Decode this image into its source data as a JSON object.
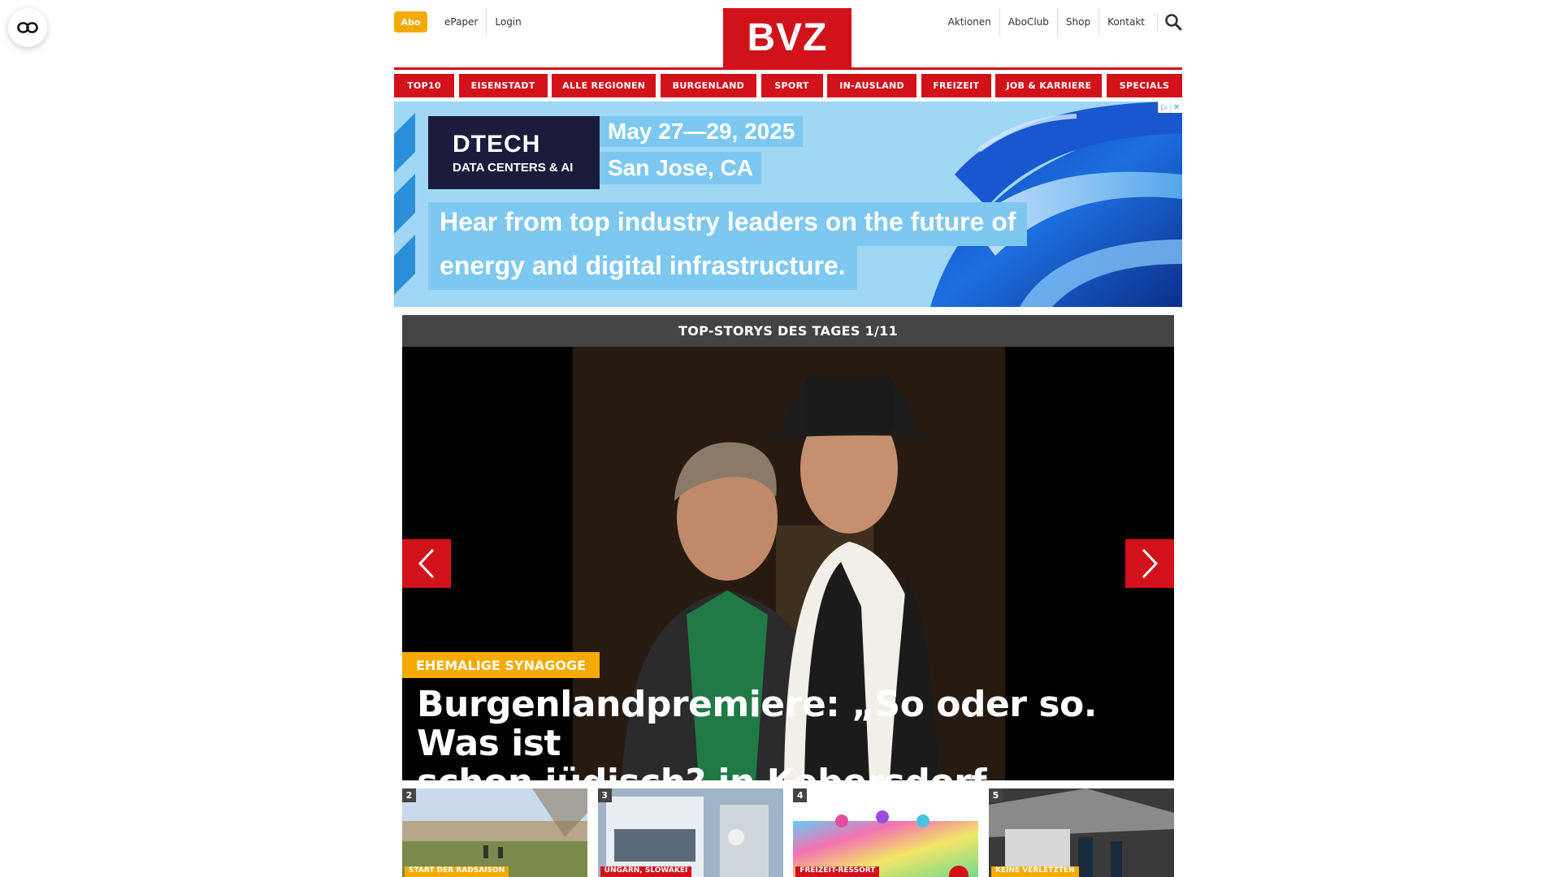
{
  "header": {
    "abo_label": "Abo",
    "left_links": [
      "ePaper",
      "Login"
    ],
    "logo_text": "BVZ",
    "right_links": [
      "Aktionen",
      "AboClub",
      "Shop",
      "Kontakt"
    ]
  },
  "nav": {
    "items": [
      "TOP10",
      "EISENSTADT",
      "ALLE REGIONEN",
      "BURGENLAND",
      "SPORT",
      "IN-AUSLAND",
      "FREIZEIT",
      "JOB & KARRIERE",
      "SPECIALS"
    ]
  },
  "ad": {
    "logo_main": "DTECH",
    "logo_sub": "DATA CENTERS & AI",
    "date": "May 27—29, 2025",
    "city": "San Jose, CA",
    "line1": "Hear from top industry leaders on the future of",
    "line2": "energy and digital infrastructure."
  },
  "slider": {
    "heading": "TOP-STORYS DES TAGES 1/11",
    "kicker": "EHEMALIGE SYNAGOGE",
    "headline_line1": "Burgenlandpremiere: „So oder so. Was ist",
    "headline_line2": "schon jüdisch? in Kobersdorf"
  },
  "teasers": [
    {
      "num": "2",
      "tag": "START DER RADSAISON"
    },
    {
      "num": "3",
      "tag": "UNGARN, SLOWAKEI"
    },
    {
      "num": "4",
      "tag": "FREIZEIT-RESSORT"
    },
    {
      "num": "5",
      "tag": "KEINE VERLETZTEN"
    }
  ],
  "colors": {
    "brand_red": "#d2121a",
    "accent_yellow": "#f4aa00",
    "ad_blue": "#7dc8f0",
    "ad_navy": "#1b1c3b"
  }
}
